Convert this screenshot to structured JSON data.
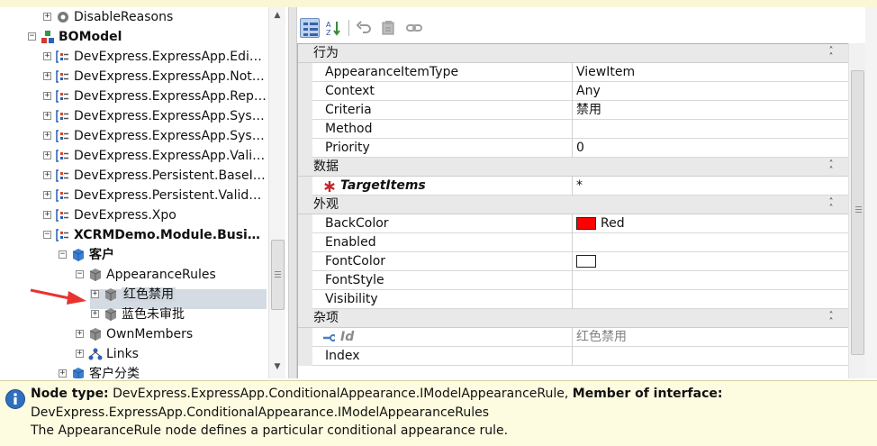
{
  "tree": {
    "nodes": [
      {
        "label": "DisableReasons",
        "bold": false,
        "expander": "+",
        "icon": "gear-icon"
      },
      {
        "label": "BOModel",
        "bold": true,
        "expander": "−",
        "icon": "model-icon"
      },
      {
        "label": "DevExpress.ExpressApp.Editors",
        "bold": false,
        "expander": "+",
        "icon": "namespace-icon"
      },
      {
        "label": "DevExpress.ExpressApp.Notifi...",
        "bold": false,
        "expander": "+",
        "icon": "namespace-icon"
      },
      {
        "label": "DevExpress.ExpressApp.Repo...",
        "bold": false,
        "expander": "+",
        "icon": "namespace-icon"
      },
      {
        "label": "DevExpress.ExpressApp.Syst...",
        "bold": false,
        "expander": "+",
        "icon": "namespace-icon"
      },
      {
        "label": "DevExpress.ExpressApp.Syst...",
        "bold": false,
        "expander": "+",
        "icon": "namespace-icon"
      },
      {
        "label": "DevExpress.ExpressApp.Valid...",
        "bold": false,
        "expander": "+",
        "icon": "namespace-icon"
      },
      {
        "label": "DevExpress.Persistent.BaseImpl",
        "bold": false,
        "expander": "+",
        "icon": "namespace-icon"
      },
      {
        "label": "DevExpress.Persistent.Validation",
        "bold": false,
        "expander": "+",
        "icon": "namespace-icon"
      },
      {
        "label": "DevExpress.Xpo",
        "bold": false,
        "expander": "+",
        "icon": "namespace-icon"
      },
      {
        "label": "XCRMDemo.Module.Busin...",
        "bold": true,
        "expander": "−",
        "icon": "namespace-icon"
      },
      {
        "label": "客户",
        "bold": true,
        "expander": "−",
        "icon": "class-icon"
      },
      {
        "label": "AppearanceRules",
        "bold": false,
        "expander": "−",
        "icon": "grey-cube-icon"
      },
      {
        "label": "红色禁用",
        "bold": false,
        "expander": "+",
        "icon": "grey-cube-icon"
      },
      {
        "label": "蓝色未审批",
        "bold": false,
        "expander": "+",
        "icon": "grey-cube-icon"
      },
      {
        "label": "OwnMembers",
        "bold": false,
        "expander": "+",
        "icon": "grey-cube-icon"
      },
      {
        "label": "Links",
        "bold": false,
        "expander": "+",
        "icon": "links-icon"
      },
      {
        "label": "客户分类",
        "bold": false,
        "expander": "+",
        "icon": "class-icon"
      }
    ]
  },
  "toolbar": {
    "buttons": [
      "categorized-view-icon",
      "sort-alphabetical-icon",
      "undo-icon",
      "reset-icon",
      "link-icon"
    ]
  },
  "grid": {
    "categories": [
      {
        "label": "行为",
        "rows": [
          {
            "name": "AppearanceItemType",
            "value": "ViewItem"
          },
          {
            "name": "Context",
            "value": "Any"
          },
          {
            "name": "Criteria",
            "value": "禁用"
          },
          {
            "name": "Method",
            "value": ""
          },
          {
            "name": "Priority",
            "value": "0"
          }
        ]
      },
      {
        "label": "数据",
        "rows": [
          {
            "name": "TargetItems",
            "value": "*",
            "required": true
          }
        ]
      },
      {
        "label": "外观",
        "rows": [
          {
            "name": "BackColor",
            "value": "Red",
            "swatch": "#ff0000"
          },
          {
            "name": "Enabled",
            "value": ""
          },
          {
            "name": "FontColor",
            "value": "",
            "swatch": "#ffffff"
          },
          {
            "name": "FontStyle",
            "value": ""
          },
          {
            "name": "Visibility",
            "value": ""
          }
        ]
      },
      {
        "label": "杂项",
        "rows": [
          {
            "name": "Id",
            "value": "红色禁用",
            "key": true
          },
          {
            "name": "Index",
            "value": ""
          }
        ]
      }
    ]
  },
  "info": {
    "node_type_label": "Node type:",
    "node_type_value": "DevExpress.ExpressApp.ConditionalAppearance.IModelAppearanceRule,",
    "member_label": "Member of interface:",
    "member_value": "DevExpress.ExpressApp.ConditionalAppearance.IModelAppearanceRules",
    "description": "The AppearanceRule node defines a particular conditional appearance rule."
  },
  "colors": {
    "accent_red": "#e8332f",
    "category_bg": "#e9e9e9",
    "info_bg": "#fdfbe0"
  }
}
